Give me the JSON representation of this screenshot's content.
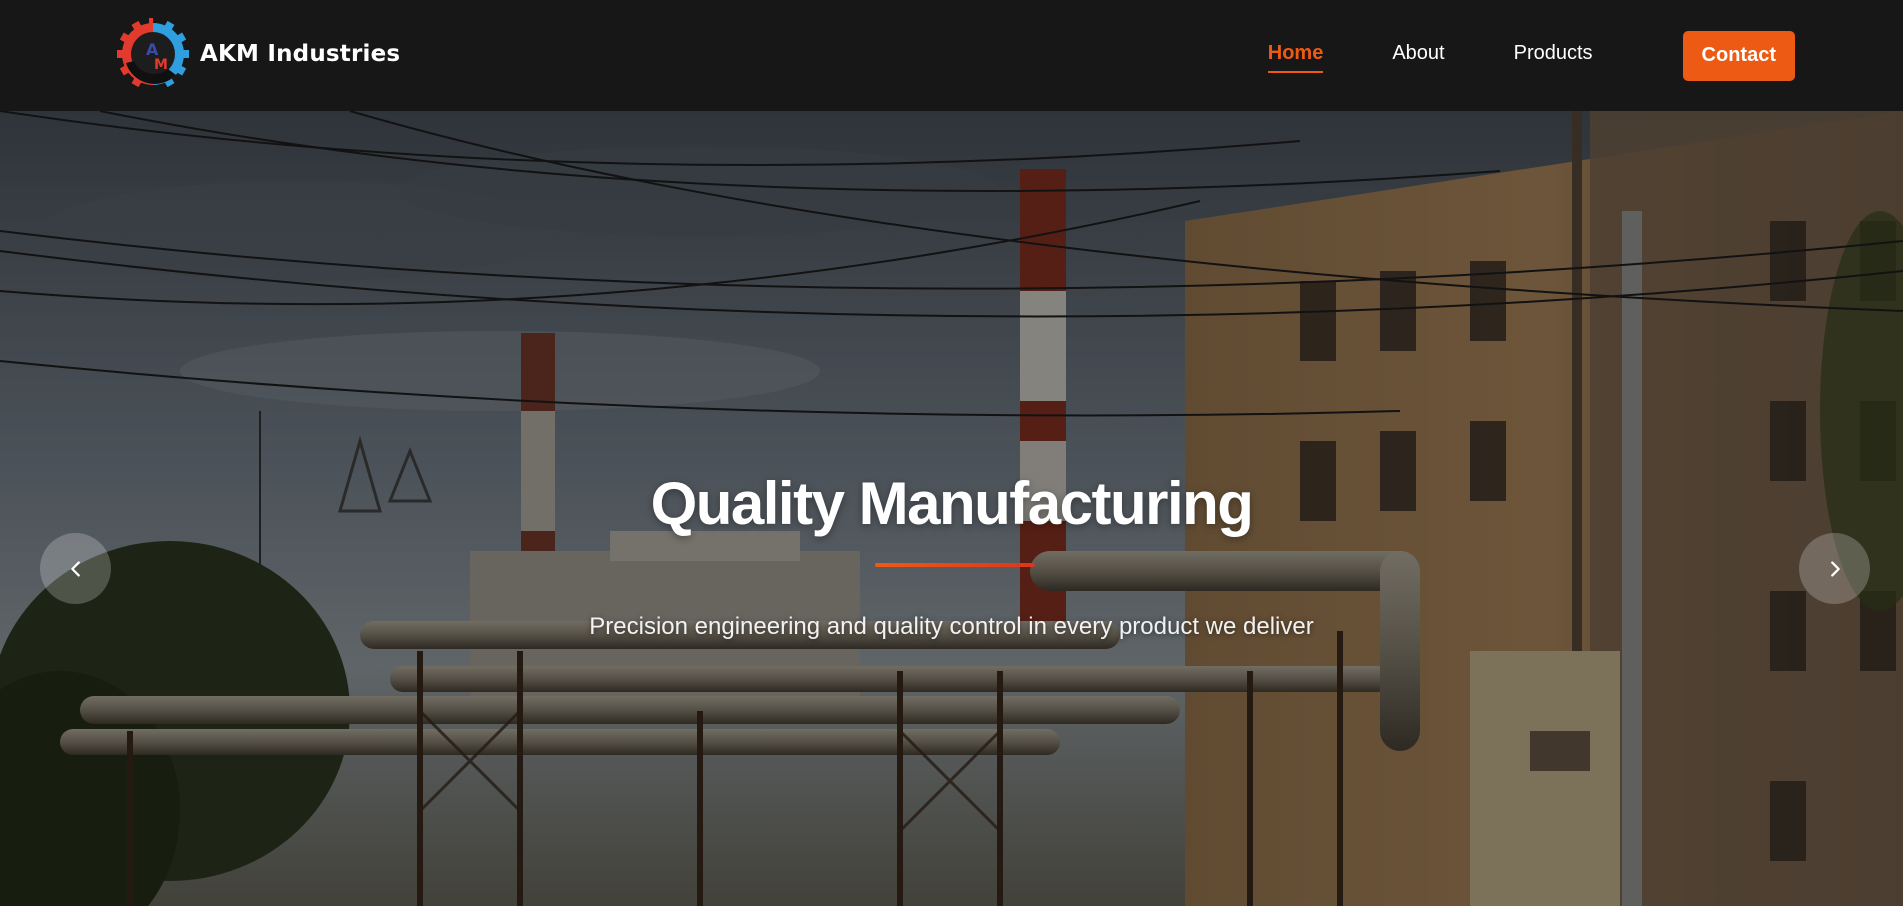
{
  "header": {
    "brand_name": "AKM Industries",
    "logo_icon": "gear-logo-icon",
    "nav": [
      {
        "label": "Home",
        "active": true
      },
      {
        "label": "About",
        "active": false
      },
      {
        "label": "Products",
        "active": false
      }
    ],
    "contact_label": "Contact"
  },
  "hero": {
    "title": "Quality Manufacturing",
    "subtitle": "Precision engineering and quality control in every product we deliver",
    "prev_icon": "chevron-left-icon",
    "next_icon": "chevron-right-icon"
  },
  "colors": {
    "accent": "#ec5a13",
    "header_bg": "#171717",
    "nav_text": "#ffffff"
  }
}
